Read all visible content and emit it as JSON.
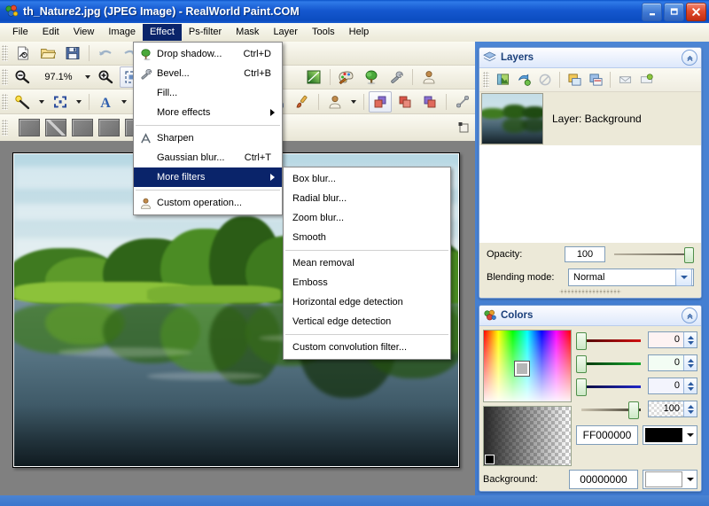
{
  "window": {
    "title": "th_Nature2.jpg (JPEG Image) - RealWorld Paint.COM",
    "icon": "app-palette-icon",
    "buttons": {
      "minimize": "–",
      "maximize": "❐",
      "close": "✕"
    }
  },
  "menubar": {
    "items": [
      {
        "label": "File",
        "active": false
      },
      {
        "label": "Edit",
        "active": false
      },
      {
        "label": "View",
        "active": false
      },
      {
        "label": "Image",
        "active": false
      },
      {
        "label": "Effect",
        "active": true
      },
      {
        "label": "Ps-filter",
        "active": false
      },
      {
        "label": "Mask",
        "active": false
      },
      {
        "label": "Layer",
        "active": false
      },
      {
        "label": "Tools",
        "active": false
      },
      {
        "label": "Help",
        "active": false
      }
    ]
  },
  "toolbar": {
    "zoom_value": "97.1%",
    "row1_icons": [
      "new-document-icon",
      "open-folder-icon",
      "save-disk-icon",
      "undo-icon",
      "redo-icon"
    ],
    "row2_icons": [
      "zoom-out-icon",
      "zoom-in-icon",
      "fit-icon",
      "gradient-icon",
      "palette-icon",
      "tree-effect-icon",
      "wrench-icon",
      "person-icon"
    ],
    "row3_icons": [
      "magic-wand-icon",
      "selection-icon",
      "text-icon",
      "finger-icon",
      "brush-icon",
      "avatar-icon",
      "layer-front-icon",
      "layer-middle-icon",
      "layer-back-icon",
      "link-icon"
    ],
    "row4_icons": [
      "swatch-1",
      "swatch-2",
      "swatch-3",
      "swatch-4",
      "swatch-5"
    ]
  },
  "effect_menu": {
    "items": [
      {
        "label": "Drop shadow...",
        "underline": "D",
        "accel": "Ctrl+D",
        "icon": "tree-icon",
        "selected": false,
        "submenu": false
      },
      {
        "label": "Bevel...",
        "underline": "B",
        "accel": "Ctrl+B",
        "icon": "wrench-icon",
        "selected": false,
        "submenu": false
      },
      {
        "label": "Fill...",
        "underline": "F",
        "accel": "",
        "icon": "",
        "selected": false,
        "submenu": false
      },
      {
        "label": "More effects",
        "underline": "",
        "accel": "",
        "icon": "",
        "selected": false,
        "submenu": true
      },
      {
        "separator": true
      },
      {
        "label": "Sharpen",
        "underline": "",
        "accel": "",
        "icon": "sharpen-icon",
        "selected": false,
        "submenu": false
      },
      {
        "label": "Gaussian blur...",
        "underline": "G",
        "accel": "Ctrl+T",
        "icon": "",
        "selected": false,
        "submenu": false
      },
      {
        "label": "More filters",
        "underline": "s",
        "accel": "",
        "icon": "",
        "selected": true,
        "submenu": true
      },
      {
        "separator": true
      },
      {
        "label": "Custom operation...",
        "underline": "o",
        "accel": "",
        "icon": "person-icon",
        "selected": false,
        "submenu": false
      }
    ]
  },
  "filters_submenu": {
    "items": [
      {
        "label": "Box blur...",
        "selected": false
      },
      {
        "label": "Radial blur...",
        "selected": false
      },
      {
        "label": "Zoom blur...",
        "selected": false
      },
      {
        "label": "Smooth",
        "selected": false
      },
      {
        "separator": true
      },
      {
        "label": "Mean removal",
        "selected": false
      },
      {
        "label": "Emboss",
        "selected": false
      },
      {
        "label": "Horizontal edge detection",
        "selected": false
      },
      {
        "label": "Vertical edge detection",
        "selected": false
      },
      {
        "separator": true
      },
      {
        "label": "Custom convolution filter...",
        "selected": false
      }
    ]
  },
  "layers_panel": {
    "title": "Layers",
    "icon": "layers-icon",
    "collapse_icon": "chevron-up-icon",
    "tool_icons": [
      "add-layer-icon",
      "duplicate-layer-icon",
      "delete-layer-icon",
      "move-up-icon",
      "move-down-icon",
      "merge-icon",
      "properties-icon"
    ],
    "layer": {
      "name": "Layer: Background",
      "thumbnail": "nature-thumbnail"
    },
    "opacity": {
      "label": "Opacity:",
      "value": "100"
    },
    "blending": {
      "label": "Blending mode:",
      "value": "Normal"
    }
  },
  "colors_panel": {
    "title": "Colors",
    "icon": "colors-icon",
    "collapse_icon": "chevron-up-icon",
    "channels": [
      {
        "name": "red",
        "value": "0",
        "color": "#7d0f0f",
        "track_end": "#d01010"
      },
      {
        "name": "green",
        "value": "0",
        "color": "#0d4a16",
        "track_end": "#17a82c"
      },
      {
        "name": "blue",
        "value": "0",
        "color": "#14165c",
        "track_end": "#2026c8"
      },
      {
        "name": "alpha",
        "value": "100",
        "color": "#6b6350",
        "track_end": "#3a3528"
      }
    ],
    "hex_value": "FF000000",
    "swatch_color": "#000000",
    "cut_row": {
      "label": "Background:",
      "hex": "00000000"
    }
  },
  "canvas": {
    "image_name": "th_Nature2.jpg",
    "description": "nature-photo-lake-reflection"
  }
}
